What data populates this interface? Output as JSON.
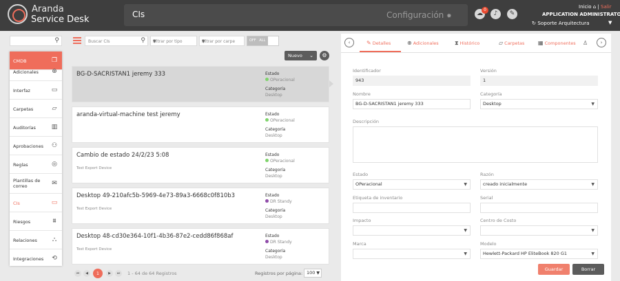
{
  "header": {
    "brand_line1": "Aranda",
    "brand_line2": "Service Desk",
    "module_title": "CIs",
    "config_label": "Configuración",
    "notification_count": "0",
    "inicio_label": "Inicio",
    "separator": "|",
    "salir_label": "Salir",
    "user_role": "APPLICATION ADMINISTRATOR",
    "project": "Soporte Arquitectura"
  },
  "sidebar": {
    "items": [
      {
        "label": "CMDB",
        "icon": "copy-icon"
      },
      {
        "label": "Adicionales",
        "icon": "plus-circle-icon"
      },
      {
        "label": "Interfaz",
        "icon": "monitor-icon"
      },
      {
        "label": "Carpetas",
        "icon": "folder-icon"
      },
      {
        "label": "Auditorías",
        "icon": "chart-icon"
      },
      {
        "label": "Aprobaciones",
        "icon": "users-icon"
      },
      {
        "label": "Reglas",
        "icon": "compass-icon"
      },
      {
        "label": "Plantillas de correo",
        "icon": "mail-icon"
      },
      {
        "label": "CIs",
        "icon": "laptop-icon"
      },
      {
        "label": "Riesgos",
        "icon": "barrier-icon"
      },
      {
        "label": "Relaciones",
        "icon": "network-icon"
      },
      {
        "label": "Integraciones",
        "icon": "sync-icon"
      }
    ]
  },
  "filters": {
    "search_placeholder": "Buscar CIs",
    "type_placeholder": "Filtrar por tipo",
    "folder_placeholder": "Filtrar por carpe",
    "toggle_off": "OFF",
    "toggle_all": "ALL"
  },
  "list": {
    "new_label": "Nuevo",
    "state_label": "Estado",
    "category_label": "Categoría",
    "items": [
      {
        "title": "BG-D-SACRISTAN1 jeremy 333",
        "subtitle": "",
        "state": "OPeracional",
        "state_color": "#7ed36b",
        "category": "Desktop"
      },
      {
        "title": "aranda-virtual-machine test jeremy",
        "subtitle": "",
        "state": "OPeracional",
        "state_color": "#7ed36b",
        "category": "Desktop"
      },
      {
        "title": "Cambio de estado 24/2/23 5:08",
        "subtitle": "Test Export Device",
        "state": "OPeracional",
        "state_color": "#7ed36b",
        "category": "Desktop"
      },
      {
        "title": "Desktop 49-210afc5b-5969-4e73-89a3-6668c0f810b3",
        "subtitle": "Test Export Device",
        "state": "DR Standy",
        "state_color": "#8e4aa8",
        "category": "Desktop"
      },
      {
        "title": "Desktop 48-cd30e364-10f1-4b36-87e2-cedd86f868af",
        "subtitle": "Test Export Device",
        "state": "DR Standy",
        "state_color": "#8e4aa8",
        "category": "Desktop"
      }
    ]
  },
  "pagination": {
    "current_page": "1",
    "info": "1 - 64 de 64 Registros",
    "per_page_label": "Registros por página:",
    "per_page_value": "100"
  },
  "detail": {
    "tabs": [
      "Detalles",
      "Adicionales",
      "Histórico",
      "Carpetas",
      "Componentes"
    ],
    "fields": {
      "identificador_label": "Identificador",
      "identificador": "943",
      "version_label": "Versión",
      "version": "1",
      "nombre_label": "Nombre",
      "nombre": "BG-D-SACRISTAN1 jeremy 333",
      "categoria_label": "Categoría",
      "categoria": "Desktop",
      "descripcion_label": "Descripción",
      "estado_label": "Estado",
      "estado": "OPeracional",
      "razon_label": "Razón",
      "razon": "creado inicialmente",
      "etiqueta_label": "Etiqueta de inventario",
      "serial_label": "Serial",
      "impacto_label": "Impacto",
      "centro_label": "Centro de Costo",
      "marca_label": "Marca",
      "modelo_label": "Modelo",
      "modelo": "Hewlett-Packard HP EliteBook 820 G1"
    },
    "save_label": "Guardar",
    "delete_label": "Borrar"
  },
  "colors": {
    "accent": "#ef6d5b",
    "header_bg": "#3e3e3e",
    "dark_button": "#5c5c5c"
  }
}
